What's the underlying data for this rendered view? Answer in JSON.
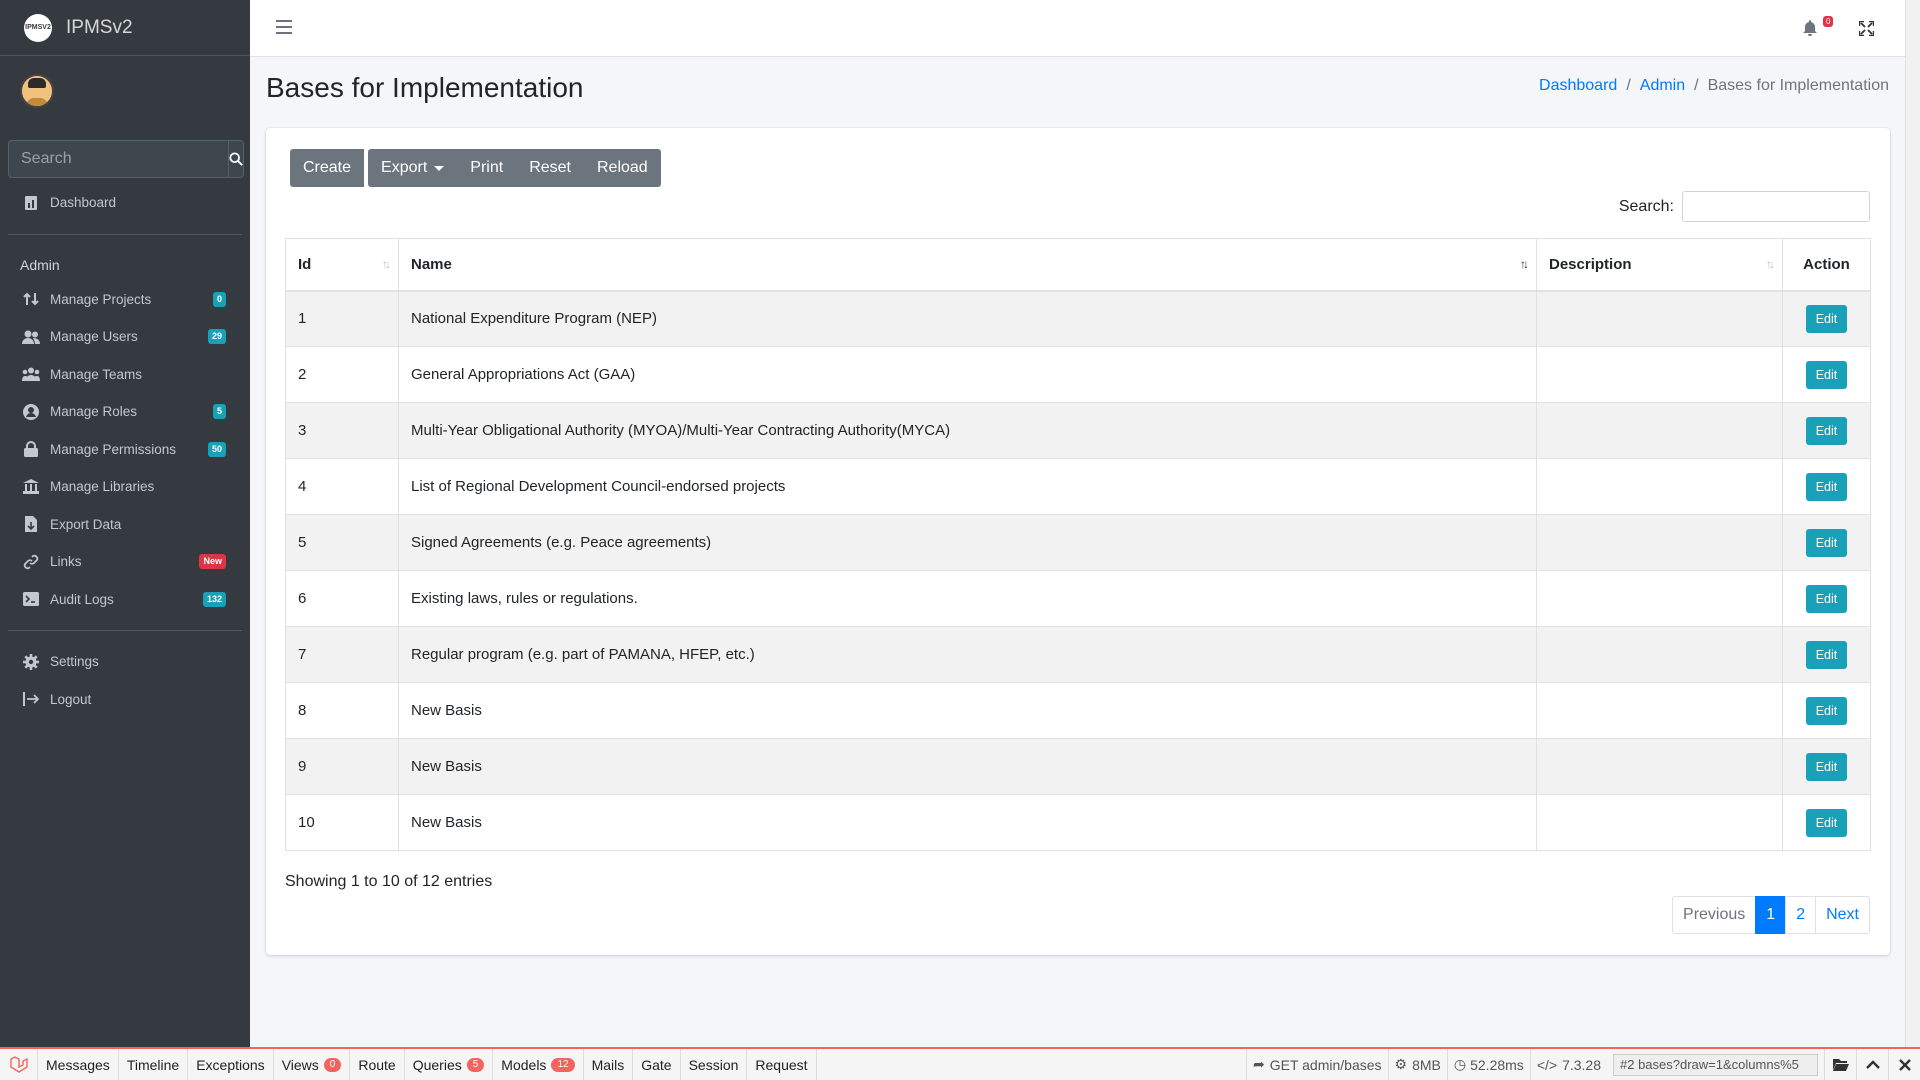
{
  "app": {
    "brand": "IPMSv2",
    "logo_text": "IPMSV2"
  },
  "sidebar": {
    "search_placeholder": "Search",
    "dashboard": "Dashboard",
    "section_header": "Admin",
    "items": [
      {
        "label": "Manage Projects",
        "badge": "0",
        "badge_color": "#17a2b8",
        "icon": "exchange-icon"
      },
      {
        "label": "Manage Users",
        "badge": "29",
        "badge_color": "#17a2b8",
        "icon": "users-icon"
      },
      {
        "label": "Manage Teams",
        "badge": "",
        "icon": "team-icon"
      },
      {
        "label": "Manage Roles",
        "badge": "5",
        "badge_color": "#17a2b8",
        "icon": "user-circle-icon"
      },
      {
        "label": "Manage Permissions",
        "badge": "50",
        "badge_color": "#17a2b8",
        "icon": "lock-icon"
      },
      {
        "label": "Manage Libraries",
        "badge": "",
        "icon": "library-icon"
      },
      {
        "label": "Export Data",
        "badge": "",
        "icon": "file-export-icon"
      },
      {
        "label": "Links",
        "badge": "New",
        "badge_color": "#dc3545",
        "icon": "link-icon"
      },
      {
        "label": "Audit Logs",
        "badge": "132",
        "badge_color": "#17a2b8",
        "icon": "terminal-icon"
      }
    ],
    "settings": "Settings",
    "logout": "Logout"
  },
  "topbar": {
    "notification_count": "0"
  },
  "page": {
    "title": "Bases for Implementation",
    "breadcrumb": [
      "Dashboard",
      "Admin",
      "Bases for Implementation"
    ]
  },
  "toolbar": {
    "create": "Create",
    "export": "Export",
    "print": "Print",
    "reset": "Reset",
    "reload": "Reload"
  },
  "table": {
    "search_label": "Search:",
    "columns": [
      "Id",
      "Name",
      "Description",
      "Action"
    ],
    "edit_label": "Edit",
    "rows": [
      {
        "id": "1",
        "name": "National Expenditure Program (NEP)",
        "description": ""
      },
      {
        "id": "2",
        "name": "General Appropriations Act (GAA)",
        "description": ""
      },
      {
        "id": "3",
        "name": "Multi-Year Obligational Authority (MYOA)/Multi-Year Contracting Authority(MYCA)",
        "description": ""
      },
      {
        "id": "4",
        "name": "List of Regional Development Council-endorsed projects",
        "description": ""
      },
      {
        "id": "5",
        "name": "Signed Agreements (e.g. Peace agreements)",
        "description": ""
      },
      {
        "id": "6",
        "name": "Existing laws, rules or regulations.",
        "description": ""
      },
      {
        "id": "7",
        "name": "Regular program (e.g. part of PAMANA, HFEP, etc.)",
        "description": ""
      },
      {
        "id": "8",
        "name": "New Basis",
        "description": ""
      },
      {
        "id": "9",
        "name": "New Basis",
        "description": ""
      },
      {
        "id": "10",
        "name": "New Basis",
        "description": ""
      }
    ],
    "info": "Showing 1 to 10 of 12 entries",
    "pagination": {
      "previous": "Previous",
      "pages": [
        "1",
        "2"
      ],
      "active": "1",
      "next": "Next"
    }
  },
  "debugbar": {
    "tabs": [
      {
        "label": "Messages",
        "count": ""
      },
      {
        "label": "Timeline",
        "count": ""
      },
      {
        "label": "Exceptions",
        "count": ""
      },
      {
        "label": "Views",
        "count": "0"
      },
      {
        "label": "Route",
        "count": ""
      },
      {
        "label": "Queries",
        "count": "5"
      },
      {
        "label": "Models",
        "count": "12"
      },
      {
        "label": "Mails",
        "count": ""
      },
      {
        "label": "Gate",
        "count": ""
      },
      {
        "label": "Session",
        "count": ""
      },
      {
        "label": "Request",
        "count": ""
      }
    ],
    "route": "GET admin/bases",
    "memory": "8MB",
    "time": "52.28ms",
    "php_version": "7.3.28",
    "request_select": "#2 bases?draw=1&columns%5"
  },
  "colors": {
    "sidebar": "#343a40",
    "primary": "#007bff",
    "info": "#17a2b8",
    "secondary": "#6c757d",
    "danger": "#dc3545"
  }
}
